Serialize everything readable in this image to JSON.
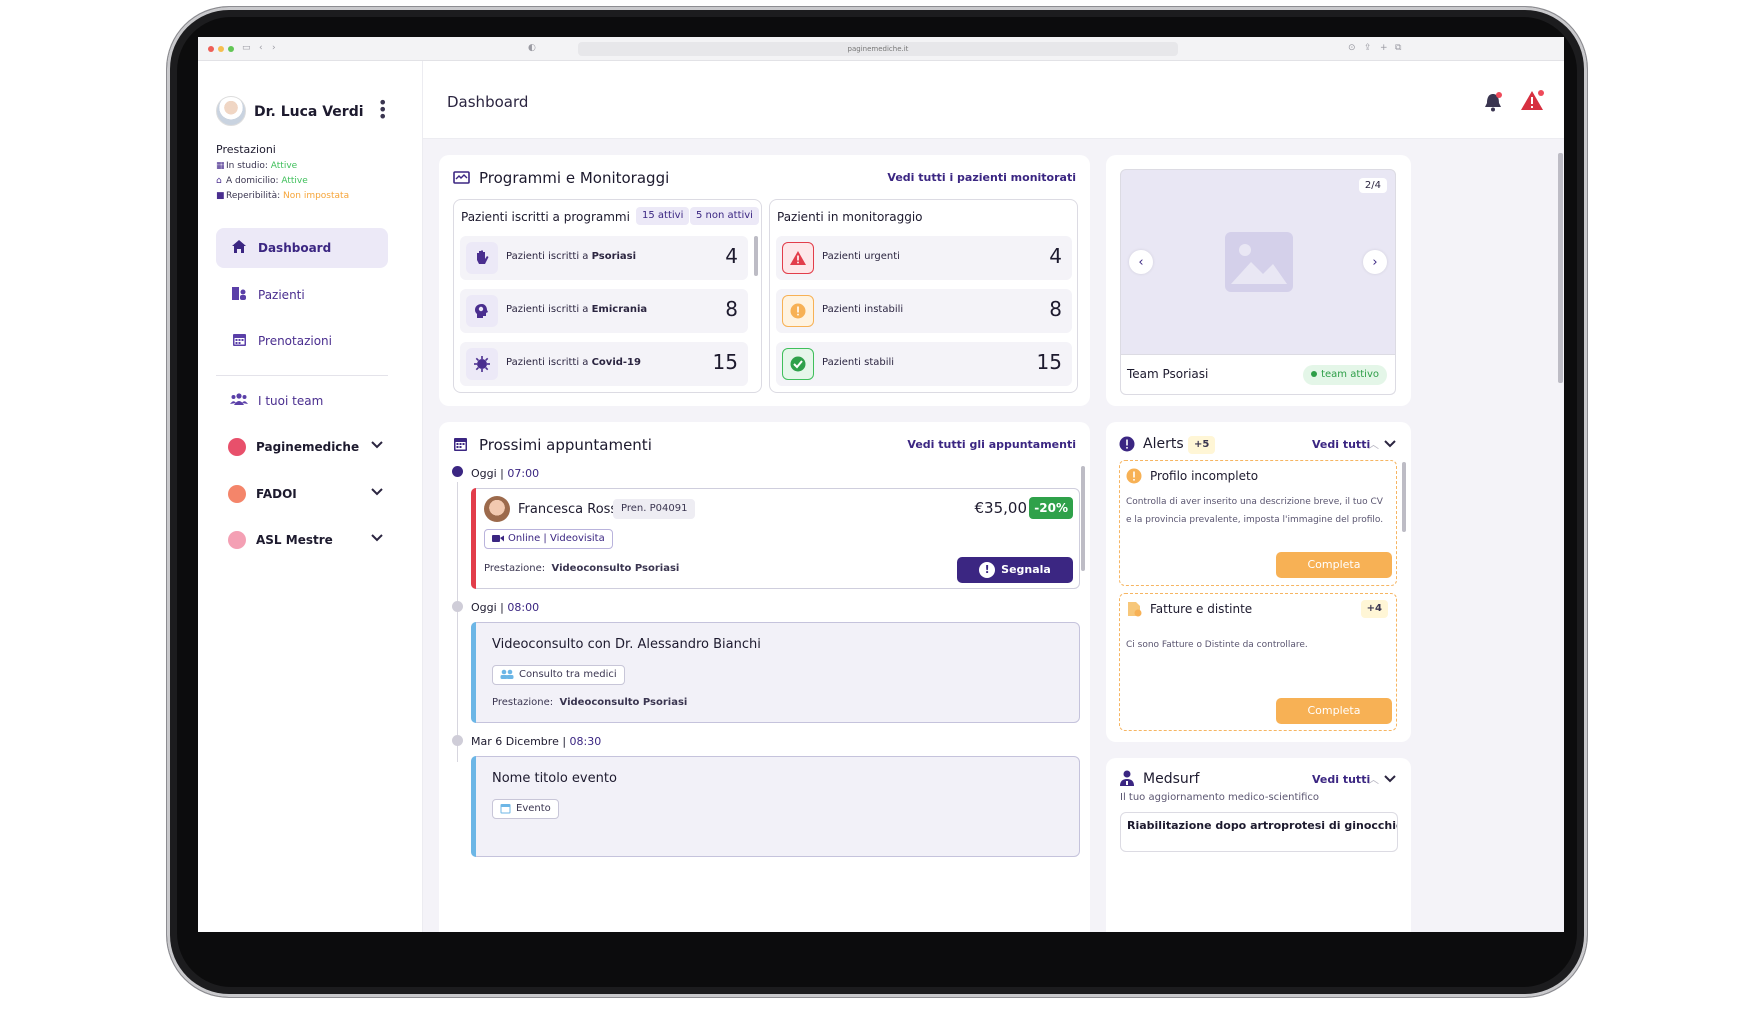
{
  "browser": {
    "url": "paginemediche.it"
  },
  "user": {
    "name": "Dr. Luca Verdi"
  },
  "prestazioni": {
    "title": "Prestazioni",
    "items": [
      {
        "label": "In studio:",
        "status": "Attive",
        "status_color": "#3fbf5b"
      },
      {
        "label": "A domicilio:",
        "status": "Attive",
        "status_color": "#3fbf5b"
      },
      {
        "label": "Reperibilità:",
        "status": "Non impostata",
        "status_color": "#f6a53a"
      }
    ]
  },
  "nav": {
    "dashboard": "Dashboard",
    "pazienti": "Pazienti",
    "prenotazioni": "Prenotazioni",
    "team": "I tuoi team"
  },
  "orgs": [
    {
      "name": "Paginemediche",
      "color": "#e8506b"
    },
    {
      "name": "FADOI",
      "color": "#f4856a"
    },
    {
      "name": "ASL Mestre",
      "color": "#f4a0b4"
    }
  ],
  "header": {
    "title": "Dashboard"
  },
  "programs": {
    "title": "Programmi e Monitoraggi",
    "link": "Vedi tutti i pazienti monitorati",
    "enrolled": {
      "title": "Pazienti iscritti a programmi",
      "active_pill": "15 attivi",
      "inactive_pill": "5 non attivi",
      "rows": [
        {
          "prefix": "Pazienti iscritti a ",
          "program": "Psoriasi",
          "value": "4"
        },
        {
          "prefix": "Pazienti iscritti a ",
          "program": "Emicrania",
          "value": "8"
        },
        {
          "prefix": "Pazienti iscritti a ",
          "program": "Covid-19",
          "value": "15"
        }
      ]
    },
    "monitoring": {
      "title": "Pazienti in monitoraggio",
      "rows": [
        {
          "label": "Pazienti urgenti",
          "value": "4"
        },
        {
          "label": "Pazienti instabili",
          "value": "8"
        },
        {
          "label": "Pazienti stabili",
          "value": "15"
        }
      ]
    }
  },
  "team_card": {
    "counter": "2/4",
    "name": "Team Psoriasi",
    "badge": "team attivo"
  },
  "appointments": {
    "title": "Prossimi appuntamenti",
    "link": "Vedi tutti gli appuntamenti",
    "groups": [
      {
        "day": "Oggi | ",
        "time": "07:00"
      },
      {
        "day": "Oggi | ",
        "time": "08:00"
      },
      {
        "day": "Mar 6 Dicembre | ",
        "time": "08:30"
      }
    ],
    "first": {
      "patient": "Francesca Rossi",
      "booking": "Pren. P04091",
      "price": "€35,00",
      "discount": "-20%",
      "mode": "Online | Videovisita",
      "prest_label": "Prestazione:",
      "prest_value": "Videoconsulto Psoriasi",
      "action": "Segnala"
    },
    "second": {
      "title": "Videoconsulto con Dr. Alessandro Bianchi",
      "chip": "Consulto tra medici",
      "prest_label": "Prestazione:",
      "prest_value": "Videoconsulto Psoriasi"
    },
    "third": {
      "title": "Nome titolo evento",
      "chip": "Evento"
    }
  },
  "alerts": {
    "title": "Alerts",
    "count": "+5",
    "link": "Vedi tutti",
    "items": [
      {
        "title": "Profilo incompleto",
        "text": "Controlla di aver inserito una descrizione breve, il tuo CV e la provincia prevalente, imposta l'immagine del profilo.",
        "button": "Completa"
      },
      {
        "title": "Fatture e distinte",
        "badge": "+4",
        "text": "Ci sono Fatture o Distinte da controllare.",
        "button": "Completa"
      }
    ]
  },
  "medsurf": {
    "title": "Medsurf",
    "subtitle": "Il tuo aggiornamento medico-scientifico",
    "link": "Vedi tutti",
    "item_title": "Riabilitazione dopo artroprotesi di ginocchio"
  },
  "colors": {
    "brand": "#3b2682",
    "danger": "#e23d4a",
    "warning": "#f7b155",
    "success": "#3fbf5b",
    "info": "#6cb6e6"
  }
}
